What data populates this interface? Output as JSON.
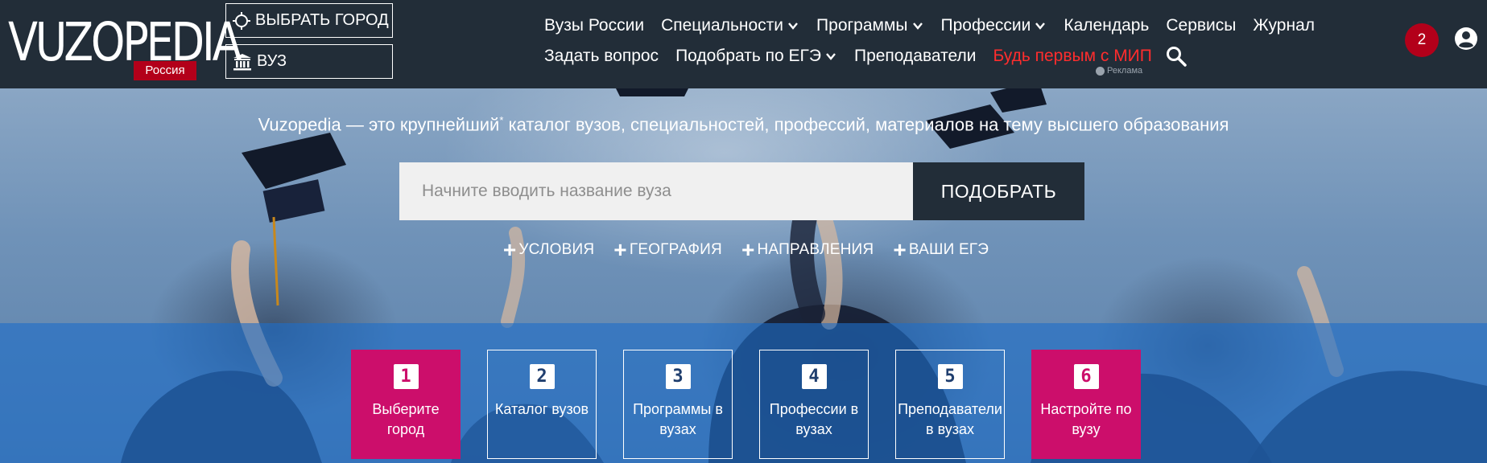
{
  "header": {
    "logo_text": "VUZOPEDIA",
    "logo_badge": "Россия",
    "city_button": "ВЫБРАТЬ ГОРОД",
    "vuz_button": "ВУЗ",
    "nav_row1": [
      {
        "label": "Вузы России",
        "dropdown": false
      },
      {
        "label": "Специальности",
        "dropdown": true
      },
      {
        "label": "Программы",
        "dropdown": true
      },
      {
        "label": "Профессии",
        "dropdown": true
      },
      {
        "label": "Календарь",
        "dropdown": false
      },
      {
        "label": "Сервисы",
        "dropdown": false
      },
      {
        "label": "Журнал",
        "dropdown": false
      }
    ],
    "nav_row2": [
      {
        "label": "Задать вопрос",
        "dropdown": false
      },
      {
        "label": "Подобрать по ЕГЭ",
        "dropdown": true
      },
      {
        "label": "Преподаватели",
        "dropdown": false
      },
      {
        "label": "Будь первым с МИП",
        "dropdown": false,
        "highlight": true
      }
    ],
    "ad_label": "Реклама",
    "notification_count": "2",
    "icons": [
      "crosshair-icon",
      "university-icon",
      "search-icon",
      "user-icon"
    ]
  },
  "hero": {
    "tagline_main": "Vuzopedia — это крупнейший",
    "tagline_mark": "*",
    "tagline_rest": " каталог вузов, специальностей, профессий, материалов на тему высшего образования",
    "search_placeholder": "Начните вводить название вуза",
    "search_button": "ПОДОБРАТЬ",
    "filters": [
      "УСЛОВИЯ",
      "ГЕОГРАФИЯ",
      "НАПРАВЛЕНИЯ",
      "ВАШИ ЕГЭ"
    ]
  },
  "steps": [
    {
      "num": "1",
      "label": "Выберите город",
      "highlight": true
    },
    {
      "num": "2",
      "label": "Каталог вузов",
      "highlight": false
    },
    {
      "num": "3",
      "label": "Программы в вузах",
      "highlight": false
    },
    {
      "num": "4",
      "label": "Профессии в вузах",
      "highlight": false
    },
    {
      "num": "5",
      "label": "Преподаватели в вузах",
      "highlight": false
    },
    {
      "num": "6",
      "label": "Настройте по вузу",
      "highlight": true
    }
  ],
  "colors": {
    "header_bg": "#222d38",
    "accent_red": "#b3001a",
    "nav_highlight": "#ff2d2d",
    "step_pink": "#cc0e6b",
    "blue_band": "#1e6ec8"
  }
}
